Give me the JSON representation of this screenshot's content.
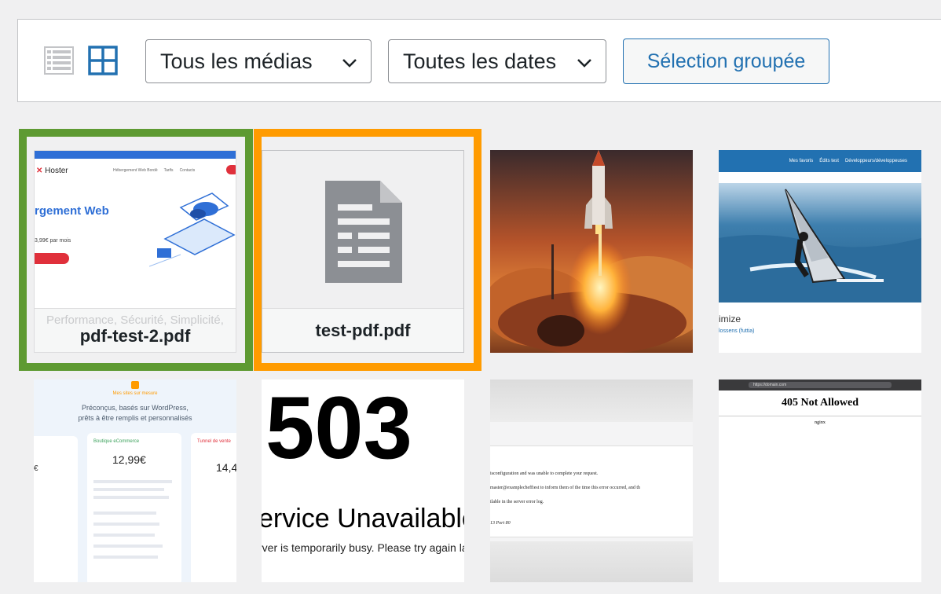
{
  "toolbar": {
    "list_view_icon": "list-view-icon",
    "grid_view_icon": "grid-view-icon",
    "media_filter": {
      "selected": "Tous les médias"
    },
    "date_filter": {
      "selected": "Toutes les dates"
    },
    "bulk_select_label": "Sélection groupée"
  },
  "colors": {
    "accent": "#2271b1",
    "highlight_green": "#5e9a32",
    "highlight_orange": "#ff9b00"
  },
  "media": [
    {
      "type": "screenshot",
      "filename": "pdf-test-2.pdf",
      "thumb": {
        "brand": "Hoster",
        "nav": [
          "Hébergement Web Bordé",
          "Tarifs",
          "Contacts"
        ],
        "heading": "rgement Web",
        "price": "3,99€ par mois",
        "footer": "Performance, Sécurité, Simplicité,"
      }
    },
    {
      "type": "pdf",
      "filename": "test-pdf.pdf"
    },
    {
      "type": "image",
      "alt": "rocket-launch"
    },
    {
      "type": "screenshot",
      "thumb": {
        "nav": [
          "Mes favoris",
          "Édits test",
          "Développeurs/développeuses"
        ],
        "text": "imize",
        "link": "lossens (futtia)"
      }
    },
    {
      "type": "screenshot",
      "thumb": {
        "tag": "Mes sites sur mesure",
        "heading": "Préconçus, basés sur WordPress, prêts à être remplis et personnalisés",
        "plan1": "Boutique eCommerce",
        "price1": "12,99€",
        "plan2": "Tunnel de vente",
        "price2": "14,4"
      }
    },
    {
      "type": "screenshot",
      "thumb": {
        "code": "503",
        "title": "ervice Unavailable",
        "message": "rver is temporarily busy. Please try again la"
      }
    },
    {
      "type": "screenshot",
      "thumb": {
        "line1": "isconfiguration and was unable to complete your request.",
        "line2": "master@examplecheffiest to inform them of the time this error occurred, and th",
        "line3": "ilable in the server error log.",
        "line4": "13 Port 80"
      }
    },
    {
      "type": "screenshot",
      "thumb": {
        "url": "https://domain.com",
        "title": "405 Not Allowed",
        "server": "nginx"
      }
    }
  ]
}
